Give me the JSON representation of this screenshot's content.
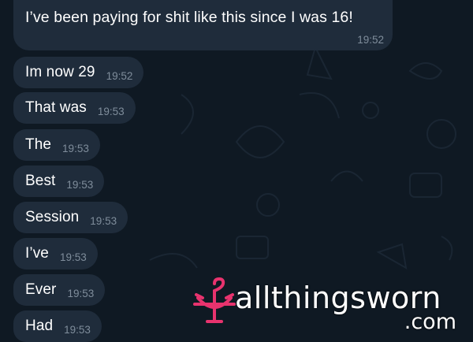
{
  "colors": {
    "background": "#0f1923",
    "bubble": "#1f2c3b",
    "text": "#ffffff",
    "timestamp": "#7f8d9b",
    "brand_pink": "#e8336e"
  },
  "messages": [
    {
      "text": "I’ve been paying for shit like this since I was 16!",
      "time": "19:52"
    },
    {
      "text": "Im now 29",
      "time": "19:52"
    },
    {
      "text": "That was",
      "time": "19:53"
    },
    {
      "text": "The",
      "time": "19:53"
    },
    {
      "text": "Best",
      "time": "19:53"
    },
    {
      "text": "Session",
      "time": "19:53"
    },
    {
      "text": "I’ve",
      "time": "19:53"
    },
    {
      "text": "Ever",
      "time": "19:53"
    },
    {
      "text": "Had",
      "time": "19:53"
    }
  ],
  "watermark": {
    "brand": "allthingsworn",
    "suffix": ".com",
    "icon": "hanger-bow-icon"
  }
}
